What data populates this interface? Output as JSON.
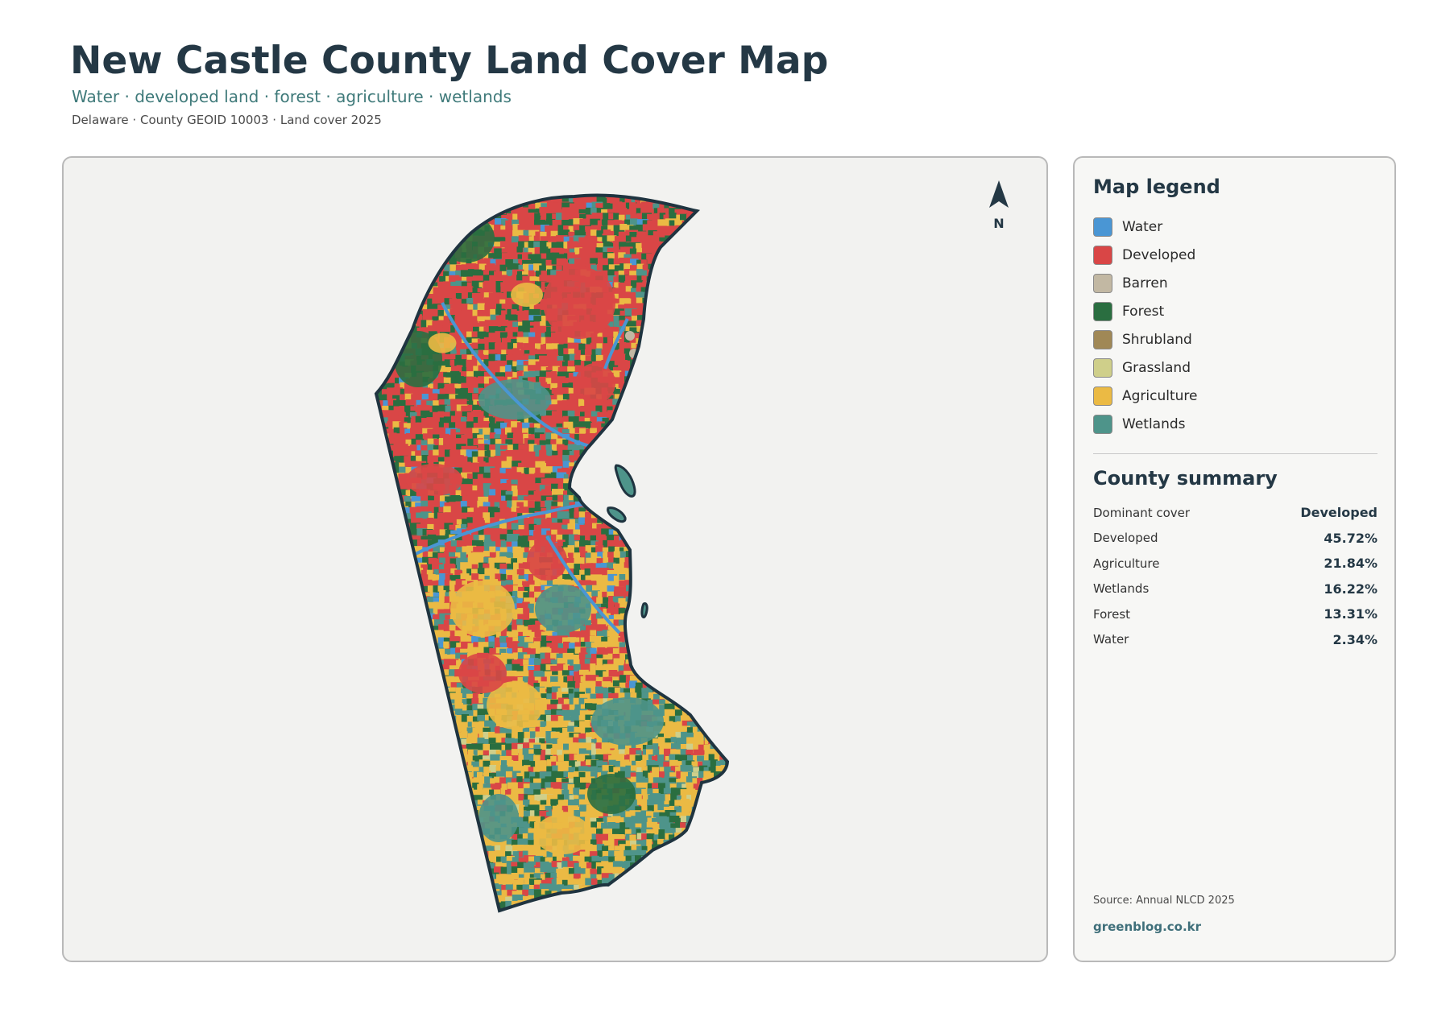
{
  "header": {
    "title": "New Castle County Land Cover Map",
    "subtitle": "Water · developed land · forest · agriculture · wetlands",
    "meta": "Delaware · County GEOID 10003 · Land cover 2025"
  },
  "map": {
    "north_label": "N",
    "colors": {
      "water": "#4a96d4",
      "developed": "#d94646",
      "barren": "#c2b8a3",
      "forest": "#2a6e40",
      "shrubland": "#a08856",
      "grassland": "#cfcf8a",
      "agriculture": "#ebba44",
      "wetlands": "#4e948a",
      "outline": "#1f3440",
      "background": "#f2f2f0"
    }
  },
  "legend": {
    "title": "Map legend",
    "items": [
      {
        "label": "Water",
        "color": "#4a96d4"
      },
      {
        "label": "Developed",
        "color": "#d94646"
      },
      {
        "label": "Barren",
        "color": "#c2b8a3"
      },
      {
        "label": "Forest",
        "color": "#2a6e40"
      },
      {
        "label": "Shrubland",
        "color": "#a08856"
      },
      {
        "label": "Grassland",
        "color": "#cfcf8a"
      },
      {
        "label": "Agriculture",
        "color": "#ebba44"
      },
      {
        "label": "Wetlands",
        "color": "#4e948a"
      }
    ]
  },
  "summary": {
    "title": "County summary",
    "rows": [
      {
        "key": "Dominant cover",
        "value": "Developed"
      },
      {
        "key": "Developed",
        "value": "45.72%"
      },
      {
        "key": "Agriculture",
        "value": "21.84%"
      },
      {
        "key": "Wetlands",
        "value": "16.22%"
      },
      {
        "key": "Forest",
        "value": "13.31%"
      },
      {
        "key": "Water",
        "value": "2.34%"
      }
    ]
  },
  "footer": {
    "source": "Source: Annual NLCD 2025",
    "site": "greenblog.co.kr"
  }
}
